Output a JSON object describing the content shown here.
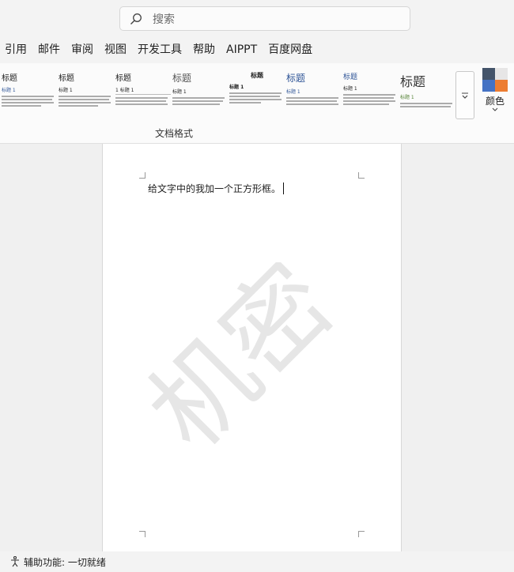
{
  "search": {
    "placeholder": "搜索",
    "icon": "search-icon"
  },
  "menu": {
    "items": [
      "引用",
      "邮件",
      "审阅",
      "视图",
      "开发工具",
      "帮助",
      "AIPPT",
      "百度网盘"
    ]
  },
  "ribbon": {
    "group_label": "文档格式",
    "styles": [
      {
        "title": "标题",
        "heading": "标题 1"
      },
      {
        "title": "标题",
        "heading": "标题 1"
      },
      {
        "title": "标题",
        "heading": "1  标题 1"
      },
      {
        "title": "标题",
        "heading": "标题 1"
      },
      {
        "title": "标题",
        "heading": "标题 1"
      },
      {
        "title": "标题",
        "heading": "标题 1"
      },
      {
        "title": "标题",
        "heading": "标题 1"
      },
      {
        "title": "标题",
        "heading": "标题 1"
      }
    ],
    "colors_label": "颜色",
    "theme_colors": [
      "#44546a",
      "#e7e6e6",
      "#4472c4",
      "#ed7d31"
    ]
  },
  "document": {
    "body_text": "给文字中的我加一个正方形框。",
    "watermark_text": "机密"
  },
  "status": {
    "text": "辅助功能: 一切就绪"
  }
}
